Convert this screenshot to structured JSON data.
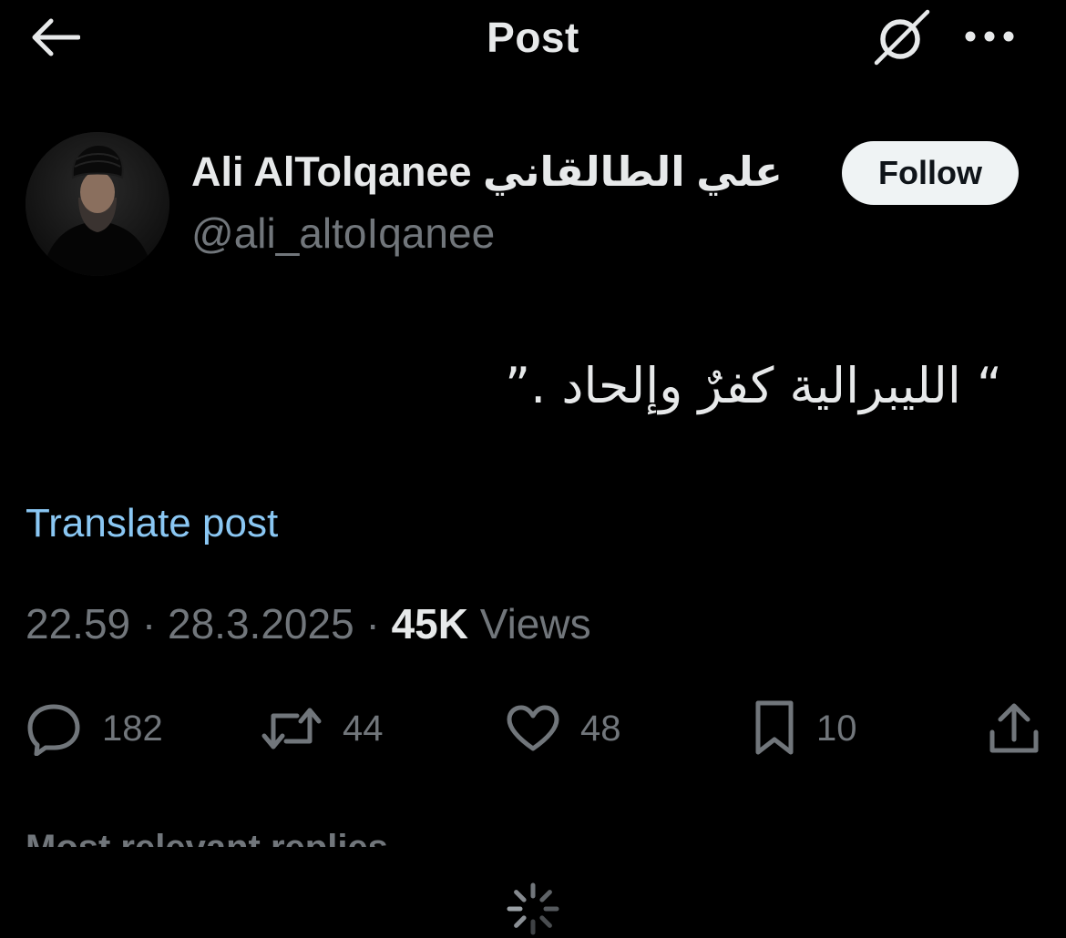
{
  "header": {
    "title": "Post",
    "back_icon": "arrow-left-icon",
    "grok_icon": "grok-icon",
    "more_icon": "more-dots-icon"
  },
  "author": {
    "display_name": "Ali AlTolqanee علي الطالقاني",
    "username": "@ali_altoIqanee",
    "follow_label": "Follow"
  },
  "post": {
    "text": "“ الليبرالية كفرٌ وإلحاد .”",
    "translate_label": "Translate post",
    "time": "22.59",
    "date": "28.3.2025",
    "separator": "·",
    "views_count": "45K",
    "views_label": "Views"
  },
  "actions": {
    "replies": "182",
    "reposts": "44",
    "likes": "48",
    "bookmarks": "10"
  },
  "replies_section": {
    "sort_label": "Most relevant replies ⌄"
  },
  "colors": {
    "background": "#000000",
    "text_primary": "#e7e9ea",
    "text_secondary": "#71767b",
    "link": "#8ac7f3",
    "follow_bg": "#eff3f4"
  }
}
